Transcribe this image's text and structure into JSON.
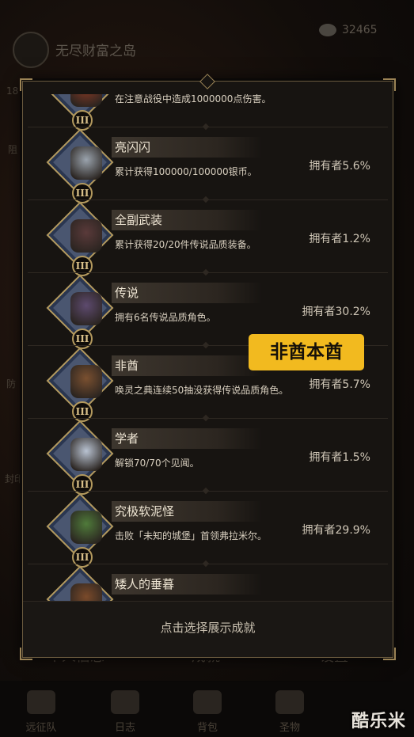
{
  "background": {
    "title": "无尽财富之岛",
    "coins": "32465",
    "tabs": [
      "个人信息",
      "成就",
      "设置"
    ],
    "nav": [
      {
        "label": "远征队",
        "icon": "helmet-icon"
      },
      {
        "label": "日志",
        "icon": "log-icon"
      },
      {
        "label": "背包",
        "icon": "bag-icon"
      },
      {
        "label": "圣物",
        "icon": "relic-icon"
      }
    ],
    "side_texts": [
      "18",
      "阻",
      "防",
      "封印"
    ]
  },
  "achievements": [
    {
      "title": "",
      "desc": "在注意战役中造成1000000点伤害。",
      "owners": "",
      "tier": "III",
      "art_color": "#8a3a24"
    },
    {
      "title": "亮闪闪",
      "desc": "累计获得100000/100000银币。",
      "owners": "拥有者5.6%",
      "tier": "III",
      "art_color": "#9aa3ad"
    },
    {
      "title": "全副武装",
      "desc": "累计获得20/20件传说品质装备。",
      "owners": "拥有者1.2%",
      "tier": "III",
      "art_color": "#5a3a3a"
    },
    {
      "title": "传说",
      "desc": "拥有6名传说品质角色。",
      "owners": "拥有者30.2%",
      "tier": "III",
      "art_color": "#5d4a6e"
    },
    {
      "title": "非酋",
      "desc": "唤灵之典连续50抽没获得传说品质角色。",
      "owners": "拥有者5.7%",
      "tier": "III",
      "art_color": "#7a5030"
    },
    {
      "title": "学者",
      "desc": "解锁70/70个见闻。",
      "owners": "拥有者1.5%",
      "tier": "III",
      "art_color": "#b9c3d2"
    },
    {
      "title": "究极软泥怪",
      "desc": "击败「未知的城堡」首领弗拉米尔。",
      "owners": "拥有者29.9%",
      "tier": "III",
      "art_color": "#4f7a3a"
    },
    {
      "title": "矮人的垂暮",
      "desc": "",
      "owners": "",
      "tier": "III",
      "art_color": "#7a4a2a"
    }
  ],
  "footer_hint": "点击选择展示成就",
  "callout": "非酋本酋",
  "watermark": "酷乐米",
  "colors": {
    "accent_gold": "#b49a5e",
    "callout_bg": "#f2ba1f"
  }
}
